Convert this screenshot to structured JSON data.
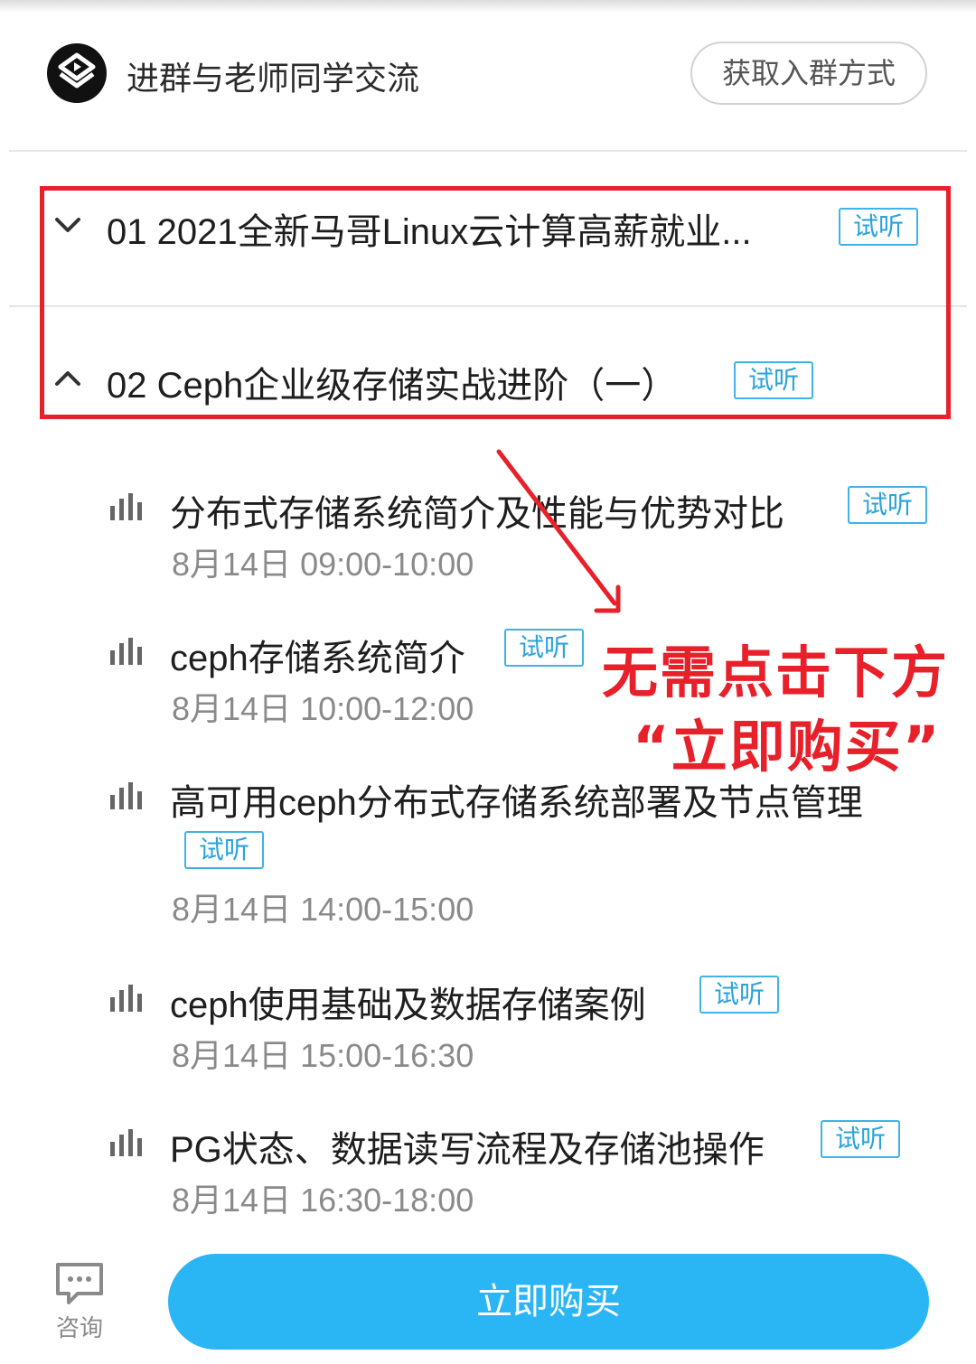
{
  "group": {
    "text": "进群与老师同学交流",
    "join_button": "获取入群方式"
  },
  "chapters": [
    {
      "title": "01 2021全新马哥Linux云计算高薪就业...",
      "tag": "试听",
      "state": "collapsed",
      "icon": "chevron-down-icon"
    },
    {
      "title": "02 Ceph企业级存储实战进阶（一）",
      "tag": "试听",
      "state": "expanded",
      "icon": "chevron-up-icon"
    }
  ],
  "lessons": [
    {
      "title": "分布式存储系统简介及性能与优势对比",
      "tag": "试听",
      "time": "8月14日 09:00-10:00"
    },
    {
      "title": "ceph存储系统简介",
      "tag": "试听",
      "time": "8月14日 10:00-12:00"
    },
    {
      "title": "高可用ceph分布式存储系统部署及节点管理",
      "tag": "试听",
      "time": "8月14日 14:00-15:00"
    },
    {
      "title": "ceph使用基础及数据存储案例",
      "tag": "试听",
      "time": "8月14日 15:00-16:30"
    },
    {
      "title": "PG状态、数据读写流程及存储池操作",
      "tag": "试听",
      "time": "8月14日 16:30-18:00"
    }
  ],
  "annotation": {
    "line1": "无需点击下方",
    "line2": "“立即购买”"
  },
  "bottom": {
    "consult_label": "咨询",
    "buy_button": "立即购买"
  },
  "colors": {
    "accent": "#2ab5f5",
    "tag_border": "#3fb3e6",
    "annotation_red": "#e8202a"
  }
}
